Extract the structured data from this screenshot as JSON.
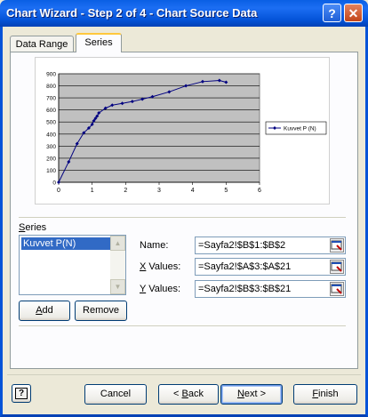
{
  "window": {
    "title": "Chart Wizard - Step 2 of 4 - Chart Source Data"
  },
  "tabs": [
    {
      "label": "Data Range",
      "selected": false
    },
    {
      "label": "Series",
      "selected": true
    }
  ],
  "chart_data": {
    "type": "line",
    "series": [
      {
        "name": "Kuvvet P (N)",
        "x": [
          0,
          0.3,
          0.55,
          0.75,
          0.9,
          1.0,
          1.05,
          1.1,
          1.15,
          1.2,
          1.4,
          1.6,
          1.9,
          2.2,
          2.5,
          2.8,
          3.3,
          3.8,
          4.3,
          4.8,
          5.0
        ],
        "y": [
          0,
          170,
          320,
          410,
          450,
          480,
          510,
          530,
          550,
          575,
          615,
          640,
          655,
          670,
          690,
          710,
          750,
          800,
          835,
          845,
          830
        ],
        "color": "#000080"
      }
    ],
    "xlim": [
      0,
      6
    ],
    "ylim": [
      0,
      900
    ],
    "xticks": [
      "0",
      "1",
      "2",
      "3",
      "4",
      "5",
      "6"
    ],
    "yticks": [
      "0",
      "100",
      "200",
      "300",
      "400",
      "500",
      "600",
      "700",
      "800",
      "900"
    ],
    "grid": true,
    "plot_background": "#C0C0C0",
    "legend_position": "right"
  },
  "series_section": {
    "label": "Series",
    "items": [
      "Kuvvet P(N)"
    ],
    "add_label": "Add",
    "remove_label": "Remove"
  },
  "fields": {
    "name_label": "Name:",
    "name_value": "=Sayfa2!$B$1:$B$2",
    "x_label": "X Values:",
    "x_value": "=Sayfa2!$A$3:$A$21",
    "y_label": "Y Values:",
    "y_value": "=Sayfa2!$B$3:$B$21"
  },
  "footer": {
    "help_icon": "help-question-icon",
    "cancel_label": "Cancel",
    "back_label": "< Back",
    "next_label": "Next >",
    "finish_label": "Finish"
  },
  "colors": {
    "titlebar": "#0453D8",
    "dialog_bg": "#ECE9D8",
    "selection": "#316AC5"
  }
}
